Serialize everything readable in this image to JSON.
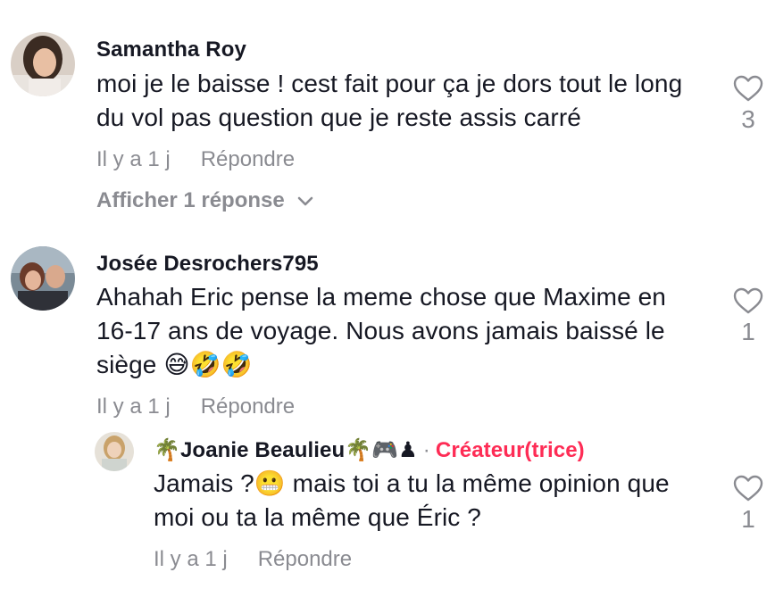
{
  "comments": [
    {
      "username": "Samantha Roy",
      "text": "moi je le baisse ! cest fait pour ça je dors tout le long du vol pas question que je reste assis carré",
      "time": "Il y a 1 j",
      "reply_label": "Répondre",
      "likes": "3",
      "show_replies_label": "Afficher 1 réponse",
      "avatar_icon": "user-avatar-photo"
    },
    {
      "username": "Josée Desrochers795",
      "text": "Ahahah Eric pense la meme chose que Maxime en 16-17 ans de voyage. Nous avons jamais baissé le siège 😅🤣🤣",
      "time": "Il y a 1 j",
      "reply_label": "Répondre",
      "likes": "1",
      "avatar_icon": "user-avatar-photo"
    }
  ],
  "reply": {
    "username": "🌴Joanie Beaulieu🌴🎮♟",
    "separator": "·",
    "creator_badge": "Créateur(trice)",
    "text": "Jamais ?😬 mais toi a tu la même opinion que moi ou ta la même que Éric ?",
    "time": "Il y a 1 j",
    "reply_label": "Répondre",
    "likes": "1",
    "avatar_icon": "user-avatar-photo"
  },
  "colors": {
    "text": "#161823",
    "muted": "#8a8b91",
    "creator": "#fe2c55",
    "heart_stroke": "#8a8b91"
  }
}
